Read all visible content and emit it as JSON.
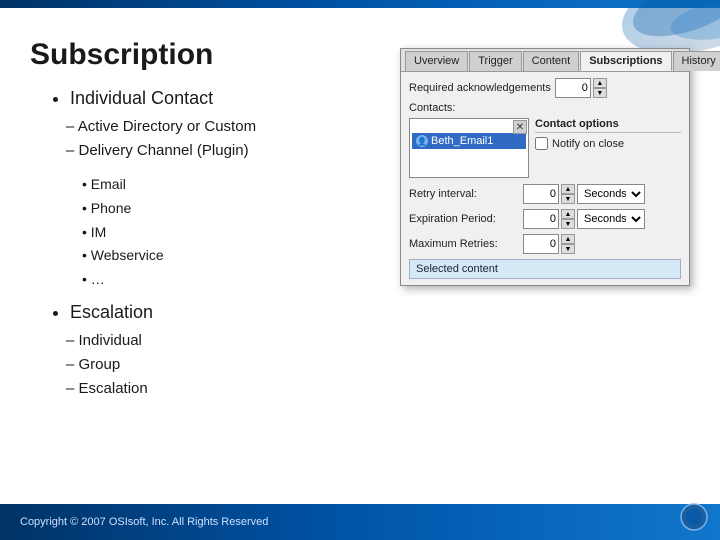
{
  "topBar": {},
  "page": {
    "title": "Subscription",
    "bullets": [
      {
        "text": "Individual Contact",
        "subItems": [
          "Active Directory or Custom",
          "Delivery Channel (Plugin)"
        ],
        "subSubItems": [
          "Email",
          "Phone",
          "IM",
          "Webservice",
          "…"
        ]
      },
      {
        "text": "Escalation",
        "subItems": [
          "Individual",
          "Group",
          "Escalation"
        ]
      }
    ]
  },
  "dialog": {
    "tabs": [
      "Uverview",
      "Trigger",
      "Content",
      "Subscriptions",
      "History"
    ],
    "activeTab": "Subscriptions",
    "requiredAck": {
      "label": "Required acknowledgements",
      "value": "0"
    },
    "contacts": {
      "label": "Contacts:",
      "item": "Beth_Email1"
    },
    "contactOptions": {
      "label": "Contact options",
      "notifyOnClose": {
        "label": "Notify on close",
        "checked": false
      }
    },
    "retryInterval": {
      "label": "Retry interval:",
      "value": "0",
      "unit": "Seconds"
    },
    "expirationPeriod": {
      "label": "Expiration Period:",
      "value": "0",
      "unit": "Seconds"
    },
    "maximumRetries": {
      "label": "Maximum Retries:",
      "value": "0"
    },
    "selectedContent": {
      "label": "Selected content"
    }
  },
  "footer": {
    "copyright": "Copyright © 2007 OSIsoft, Inc. All Rights Reserved"
  }
}
